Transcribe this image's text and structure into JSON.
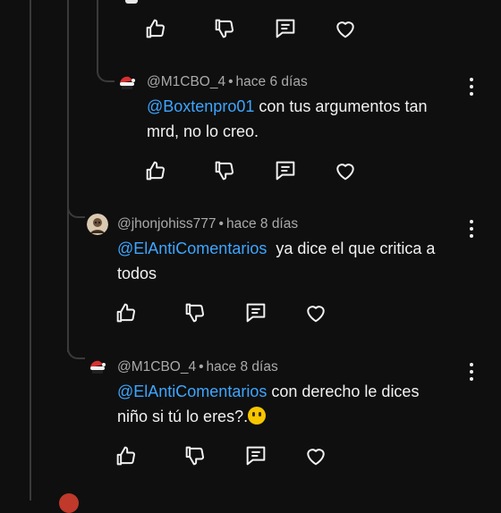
{
  "colors": {
    "background": "#0f0f0f",
    "text": "#f1f1f1",
    "meta": "#aaaaaa",
    "mention": "#3ea6ff",
    "thread_line": "#3a3a3a"
  },
  "comments": [
    {
      "author": "@M1CBO_4",
      "time": "hace 6 días",
      "mention": "@Boxtenpro01",
      "text_line1": " con tus argumentos tan",
      "text_line2": "mrd, no lo creo.",
      "avatar_icon": "santa-hat-avatar-icon"
    },
    {
      "author": "@jhonjohiss777",
      "time": "hace 8 días",
      "mention": "@ElAntiComentarios",
      "text_line1": "  ya dice el que critica a",
      "text_line2": "todos",
      "avatar_icon": "person-avatar-icon"
    },
    {
      "author": "@M1CBO_4",
      "time": "hace 8 días",
      "mention": "@ElAntiComentarios",
      "text_line1": " con derecho le dices",
      "text_line2": "niño si tú lo eres?.",
      "emoji": "hushed-face-emoji",
      "avatar_icon": "santa-hat-avatar-icon"
    }
  ],
  "separator": "•",
  "icons": {
    "like": "thumbs-up-icon",
    "dislike": "thumbs-down-icon",
    "reply": "reply-comment-icon",
    "heart": "heart-icon",
    "more": "more-vert-icon"
  }
}
